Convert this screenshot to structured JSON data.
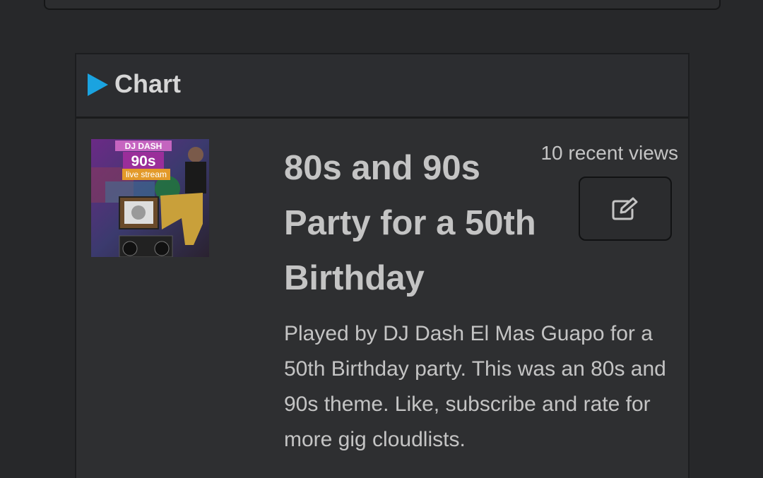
{
  "section": {
    "title": "Chart"
  },
  "item": {
    "title": "80s and 90s Party for a 50th Birthday",
    "recent_views": "10 recent views",
    "description": "Played by DJ Dash El Mas Guapo for a 50th Birthday party. This was an 80s and 90s theme. Like, subscribe and rate for more gig cloudlists.",
    "thumbnail": {
      "logo_text": "DJ DASH",
      "badge_text": "90s",
      "banner_text": "live stream"
    },
    "edit_icon": "edit-icon"
  },
  "colors": {
    "background": "#27282a",
    "accent": "#1aa3e0",
    "text": "#c4c4c4"
  }
}
